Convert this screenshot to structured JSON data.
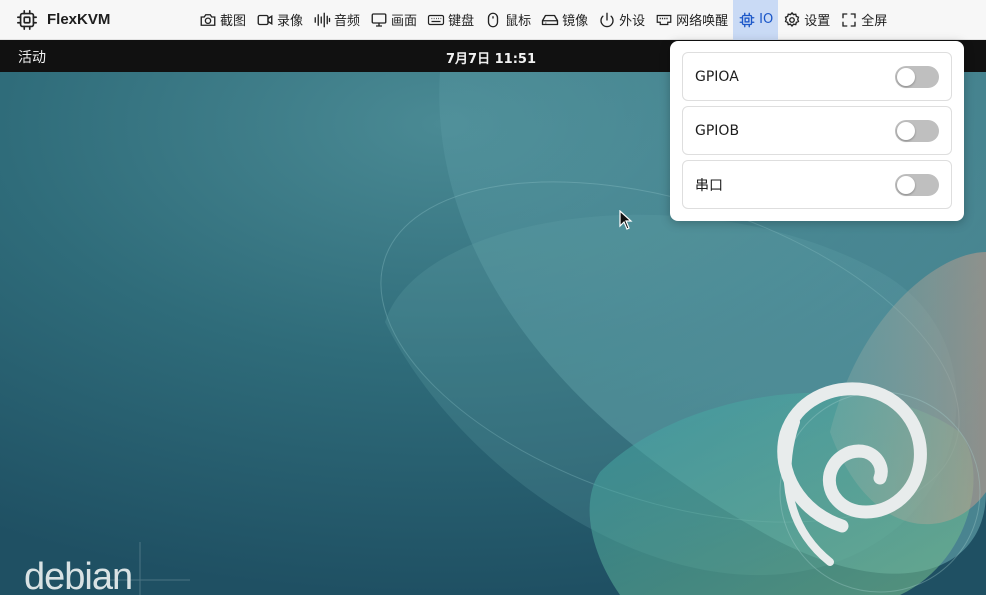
{
  "app": {
    "name": "FlexKVM",
    "icon": "chip-icon"
  },
  "toolbar": {
    "items": [
      {
        "label": "截图",
        "icon": "camera-icon"
      },
      {
        "label": "录像",
        "icon": "video-icon"
      },
      {
        "label": "音频",
        "icon": "audio-wave-icon"
      },
      {
        "label": "画面",
        "icon": "monitor-icon"
      },
      {
        "label": "键盘",
        "icon": "keyboard-icon"
      },
      {
        "label": "鼠标",
        "icon": "mouse-icon"
      },
      {
        "label": "镜像",
        "icon": "drive-icon"
      },
      {
        "label": "外设",
        "icon": "power-icon"
      },
      {
        "label": "网络唤醒",
        "icon": "ethernet-icon"
      },
      {
        "label": "IO",
        "icon": "chip-icon",
        "active": true
      },
      {
        "label": "设置",
        "icon": "gear-icon"
      },
      {
        "label": "全屏",
        "icon": "fullscreen-icon"
      }
    ]
  },
  "remote": {
    "activities": "活动",
    "clock": "7月7日  11:51",
    "wallpaper_text": "debian"
  },
  "io_panel": {
    "rows": [
      {
        "label": "GPIOA",
        "on": false
      },
      {
        "label": "GPIOB",
        "on": false
      },
      {
        "label": "串口",
        "on": false
      }
    ]
  },
  "colors": {
    "accent": "#1a56c8",
    "active_bg": "#c9daf5",
    "toggle_off": "#bfbfbf",
    "gnome_bar": "#111111"
  }
}
